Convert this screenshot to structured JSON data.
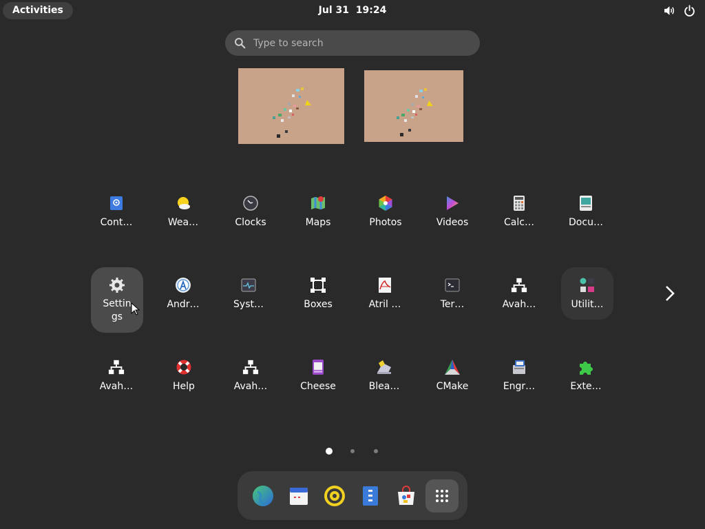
{
  "topbar": {
    "activities_label": "Activities",
    "date": "Jul 31",
    "time": "19:24",
    "icons": [
      "volume-icon",
      "power-icon"
    ]
  },
  "search": {
    "placeholder": "Type to search"
  },
  "workspaces": [
    {
      "name": "workspace-1"
    },
    {
      "name": "workspace-2"
    }
  ],
  "apps": {
    "row1": [
      {
        "label": "Cont…",
        "icon": "contacts-icon"
      },
      {
        "label": "Wea…",
        "icon": "weather-icon"
      },
      {
        "label": "Clocks",
        "icon": "clocks-icon"
      },
      {
        "label": "Maps",
        "icon": "maps-icon"
      },
      {
        "label": "Photos",
        "icon": "photos-icon"
      },
      {
        "label": "Videos",
        "icon": "videos-icon"
      },
      {
        "label": "Calc…",
        "icon": "calculator-icon"
      },
      {
        "label": "Docu…",
        "icon": "document-viewer-icon"
      }
    ],
    "row2": [
      {
        "label": "Settin gs",
        "icon": "settings-icon"
      },
      {
        "label": "Andr…",
        "icon": "android-studio-icon"
      },
      {
        "label": "Syst…",
        "icon": "system-monitor-icon"
      },
      {
        "label": "Boxes",
        "icon": "boxes-icon"
      },
      {
        "label": "Atril …",
        "icon": "atril-icon"
      },
      {
        "label": "Ter…",
        "icon": "terminal-icon"
      },
      {
        "label": "Avah…",
        "icon": "network-icon"
      },
      {
        "label": "Utilit…",
        "icon": "utilities-folder-icon"
      }
    ],
    "row3": [
      {
        "label": "Avah…",
        "icon": "network-icon"
      },
      {
        "label": "Help",
        "icon": "help-icon"
      },
      {
        "label": "Avah…",
        "icon": "network-icon"
      },
      {
        "label": "Cheese",
        "icon": "cheese-icon"
      },
      {
        "label": "Blea…",
        "icon": "bleachbit-icon"
      },
      {
        "label": "CMake",
        "icon": "cmake-icon"
      },
      {
        "label": "Engr…",
        "icon": "engrampa-icon"
      },
      {
        "label": "Exte…",
        "icon": "extensions-icon"
      }
    ]
  },
  "pager": {
    "pages": 3,
    "current": 1
  },
  "dash": [
    {
      "name": "web-browser",
      "icon": "globe-icon"
    },
    {
      "name": "calendar",
      "icon": "calendar-icon"
    },
    {
      "name": "rhythmbox",
      "icon": "music-icon"
    },
    {
      "name": "files",
      "icon": "files-icon"
    },
    {
      "name": "software",
      "icon": "software-store-icon"
    },
    {
      "name": "show-apps",
      "icon": "app-grid-icon"
    }
  ],
  "colors": {
    "background": "#2a2a2a",
    "pill": "#3f3f3f",
    "search_bg": "#4a4a4a",
    "selected_tile": "#4b4b4b",
    "dash_bg": "#3b3b3b"
  }
}
